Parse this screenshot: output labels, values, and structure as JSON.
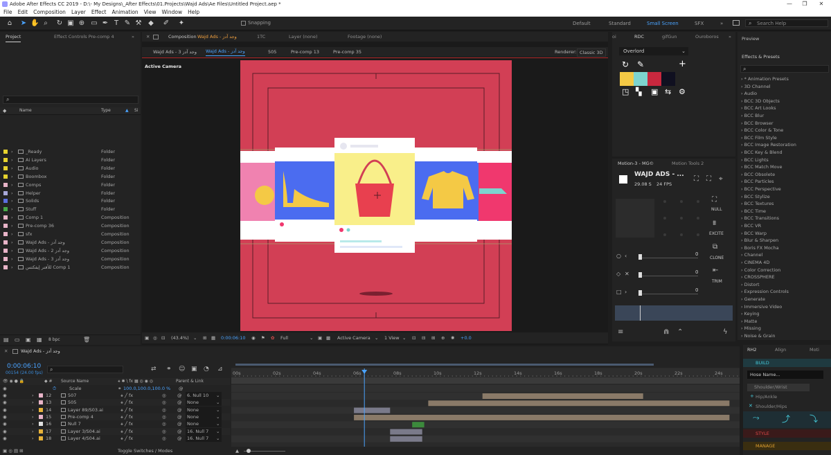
{
  "titlebar": {
    "title": "Adobe After Effects CC 2019 - D:\\- My Designs\\_After Effects\\01.Projects\\Wajd Ads\\Ae Files\\Untitled Project.aep *"
  },
  "menubar": [
    "File",
    "Edit",
    "Composition",
    "Layer",
    "Effect",
    "Animation",
    "View",
    "Window",
    "Help"
  ],
  "toolbar": {
    "snapping": "Snapping",
    "workspaces": [
      "Default",
      "Standard",
      "Small Screen",
      "SFX"
    ],
    "active_workspace": "Small Screen",
    "search_placeholder": "Search Help"
  },
  "project": {
    "tab": "Project",
    "effect_controls": "Effect Controls Pre-comp 4",
    "col_name": "Name",
    "col_type": "Type",
    "col_size": "Si",
    "items": [
      {
        "name": "_Ready",
        "type": "Folder",
        "color": "#e6d22e"
      },
      {
        "name": "Ai Layers",
        "type": "Folder",
        "color": "#e6d22e"
      },
      {
        "name": "Audio",
        "type": "Folder",
        "color": "#e6d22e"
      },
      {
        "name": "Boombox",
        "type": "Folder",
        "color": "#e6d22e"
      },
      {
        "name": "Comps",
        "type": "Folder",
        "color": "#e8b4c8"
      },
      {
        "name": "Helper",
        "type": "Folder",
        "color": "#a8a8d8"
      },
      {
        "name": "Solids",
        "type": "Folder",
        "color": "#5b6ee0"
      },
      {
        "name": "Stuff",
        "type": "Folder",
        "color": "#48a848"
      },
      {
        "name": "Comp 1",
        "type": "Composition",
        "color": "#e8b4c8"
      },
      {
        "name": "Pre-comp 36",
        "type": "Composition",
        "color": "#e8b4c8"
      },
      {
        "name": "sfx",
        "type": "Composition",
        "color": "#e8b4c8"
      },
      {
        "name": "Wajd Ads - وجد آدز",
        "type": "Composition",
        "color": "#e8b4c8"
      },
      {
        "name": "Wajd Ads - 2 وجد آدز",
        "type": "Composition",
        "color": "#e8b4c8"
      },
      {
        "name": "Wajd Ads - 3 وجد آدز",
        "type": "Composition",
        "color": "#e8b4c8"
      },
      {
        "name": "للأفتر إيفكتس Comp 1",
        "type": "Composition",
        "color": "#e8b4c8"
      }
    ],
    "bpc": "8 bpc"
  },
  "comp": {
    "tab_prefix": "Composition",
    "tab_name": "Wajd Ads - وجد آدز",
    "tab_1tc": "1TC",
    "layer_tab": "Layer (none)",
    "footage_tab": "Footage (none)",
    "breadcrumbs": [
      "Wajd Ads - 3 وجد آدز",
      "Wajd Ads - وجد آدز",
      "505",
      "Pre-comp 13",
      "Pre-comp 35"
    ],
    "renderer": "Renderer:",
    "renderer_value": "Classic 3D",
    "active_camera": "Active Camera",
    "zoom": "(43.4%)",
    "time": "0:00:06:10",
    "quality": "Full",
    "view_camera": "Active Camera",
    "view_count": "1 View",
    "exposure": "+0.0"
  },
  "rdc": {
    "tabs": [
      "oi",
      "RDC",
      "gifGun",
      "Ouroboros"
    ],
    "dropdown": "Overlord",
    "colors": [
      "#f4c945",
      "#7dd4cf",
      "#c8283e",
      "#101020"
    ]
  },
  "motion": {
    "tabs": [
      "Motion-3 - MG©",
      "Motion Tools 2"
    ],
    "comp_name": "WAJD ADS - ...",
    "duration": "29.08 S",
    "fps": "24 FPS",
    "buttons": [
      "NULL",
      "EXCITE",
      "CLONE",
      "TRIM"
    ],
    "slider_values": [
      "0",
      "0",
      "0"
    ]
  },
  "effects": {
    "preview": "Preview",
    "title": "Effects & Presets",
    "items": [
      "* Animation Presets",
      "3D Channel",
      "Audio",
      "BCC 3D Objects",
      "BCC Art Looks",
      "BCC Blur",
      "BCC Browser",
      "BCC Color & Tone",
      "BCC Film Style",
      "BCC Image Restoration",
      "BCC Key & Blend",
      "BCC Lights",
      "BCC Match Move",
      "BCC Obsolete",
      "BCC Particles",
      "BCC Perspective",
      "BCC Stylize",
      "BCC Textures",
      "BCC Time",
      "BCC Transitions",
      "BCC VR",
      "BCC Warp",
      "Blur & Sharpen",
      "Boris FX Mocha",
      "Channel",
      "CINEMA 4D",
      "Color Correction",
      "CROSSPHERE",
      "Distort",
      "Expression Controls",
      "Generate",
      "Immersive Video",
      "Keying",
      "Matte",
      "Missing",
      "Noise & Grain"
    ]
  },
  "rh2": {
    "tabs": [
      "RH2",
      "Align",
      "Moti"
    ],
    "build": "BUILD",
    "name_placeholder": "Hose Name...",
    "options": [
      "Shoulder/Wrist",
      "Hip/Ankle",
      "Shoulder/Hips"
    ],
    "style": "STYLE",
    "manage": "MANAGE"
  },
  "timeline": {
    "comp_tab": "Wajd Ads - وجد آدز",
    "timecode": "0:00:06:10",
    "frames": "00154 (24.00 fps)",
    "col_source": "Source Name",
    "col_parent": "Parent & Link",
    "ruler": [
      "00s",
      "02s",
      "04s",
      "06s",
      "08s",
      "10s",
      "12s",
      "14s",
      "16s",
      "18s",
      "20s",
      "22s",
      "24s"
    ],
    "scale_label": "Scale",
    "scale_value": "100.0,100.0,100.0 %",
    "layers": [
      {
        "num": "12",
        "name": "507",
        "parent": "6. Null 10",
        "color": "#e8b4c8",
        "bar_start": 12.3,
        "bar_end": 20.3,
        "bar_color": "#8a7a68"
      },
      {
        "num": "13",
        "name": "505",
        "parent": "None",
        "color": "#e8b4c8",
        "bar_start": 9.6,
        "bar_end": 24.6,
        "bar_color": "#8a7a68"
      },
      {
        "num": "14",
        "name": "Layer 89/S03.ai",
        "parent": "None",
        "color": "#e6b23a",
        "bar_start": 5.9,
        "bar_end": 7.7,
        "bar_color": "#7a7a8a"
      },
      {
        "num": "15",
        "name": "Pre-comp 4",
        "parent": "None",
        "color": "#e8b4c8",
        "bar_start": 5.9,
        "bar_end": 24.6,
        "bar_color": "#8a7a68"
      },
      {
        "num": "16",
        "name": "Null 7",
        "parent": "None",
        "color": "#e0e0e0",
        "bar_start": 8.8,
        "bar_end": 9.4,
        "bar_color": "#3c8a3c"
      },
      {
        "num": "17",
        "name": "Layer 3/S04.ai",
        "parent": "16. Null 7",
        "color": "#e6b23a",
        "bar_start": 7.7,
        "bar_end": 9.3,
        "bar_color": "#7a7a8a"
      },
      {
        "num": "18",
        "name": "Layer 4/S04.ai",
        "parent": "16. Null 7",
        "color": "#e6b23a",
        "bar_start": 7.7,
        "bar_end": 9.3,
        "bar_color": "#7a7a8a"
      }
    ],
    "toggle": "Toggle Switches / Modes",
    "current_time_sec": 6.42
  }
}
